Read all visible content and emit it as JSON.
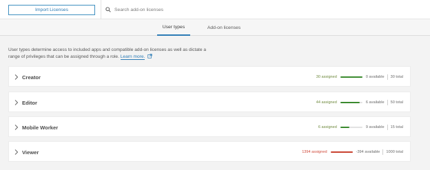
{
  "toolbar": {
    "import_label": "Import Licenses",
    "search_placeholder": "Search add-on licenses"
  },
  "tabs": [
    {
      "label": "User types",
      "active": true
    },
    {
      "label": "Add-on licenses",
      "active": false
    }
  ],
  "description": {
    "text": "User types determine access to included apps and compatible add-on licenses as well as dictate a range of privileges that can be assigned through a role.",
    "link_label": "Learn more."
  },
  "colors": {
    "accent": "#2b7bb5",
    "bar_green": "#3a8a2e",
    "bar_red": "#c9412f"
  },
  "rows": [
    {
      "name": "Creator",
      "assigned": "30 assigned",
      "available": "0 available",
      "total": "30 total",
      "fill_fraction": 1.0,
      "over": false
    },
    {
      "name": "Editor",
      "assigned": "44 assigned",
      "available": "6 available",
      "total": "50 total",
      "fill_fraction": 0.88,
      "over": false
    },
    {
      "name": "Mobile Worker",
      "assigned": "6 assigned",
      "available": "9 available",
      "total": "15 total",
      "fill_fraction": 0.4,
      "over": false
    },
    {
      "name": "Viewer",
      "assigned": "1394 assigned",
      "available": "-394 available",
      "total": "1000 total",
      "fill_fraction": 1.0,
      "over": true
    }
  ]
}
